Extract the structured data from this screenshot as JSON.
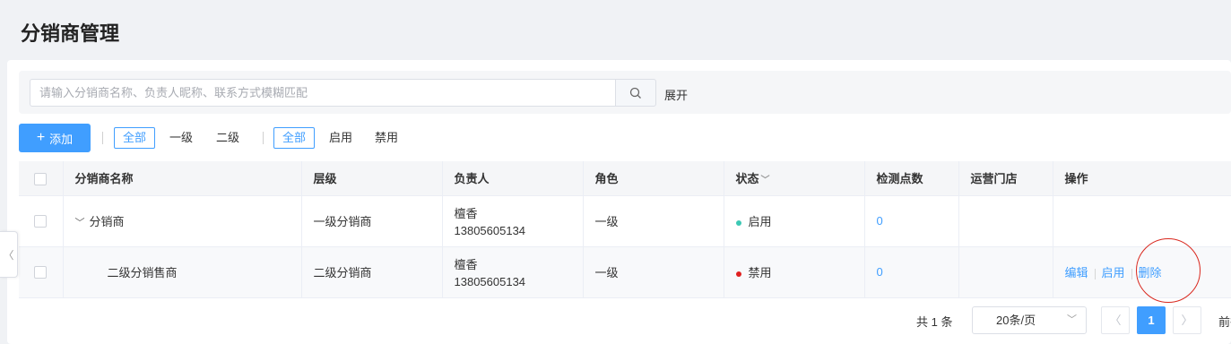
{
  "page": {
    "title": "分销商管理"
  },
  "search": {
    "placeholder": "请输入分销商名称、负责人昵称、联系方式模糊匹配",
    "value": "",
    "expand_label": "展开"
  },
  "toolbar": {
    "add_label": "添加",
    "level_filters": [
      "全部",
      "一级",
      "二级"
    ],
    "status_filters": [
      "全部",
      "启用",
      "禁用"
    ]
  },
  "table": {
    "columns": [
      "分销商名称",
      "层级",
      "负责人",
      "角色",
      "状态",
      "检测点数",
      "运营门店",
      "操作"
    ],
    "rows": [
      {
        "name": "分销商",
        "level": "一级分销商",
        "owner_name": "檀香",
        "owner_phone": "13805605134",
        "role": "一级",
        "status": "启用",
        "status_color": "#3cc8b4",
        "points": "0",
        "stores": "",
        "actions": []
      },
      {
        "name": "二级分销售商",
        "level": "二级分销商",
        "owner_name": "檀香",
        "owner_phone": "13805605134",
        "role": "一级",
        "status": "禁用",
        "status_color": "#e02020",
        "points": "0",
        "stores": "",
        "actions": [
          "编辑",
          "启用",
          "删除"
        ]
      }
    ]
  },
  "pagination": {
    "total_text": "共 1 条",
    "page_size": "20条/页",
    "current_page": "1",
    "goto_text": "前往"
  },
  "colors": {
    "accent": "#409eff",
    "annotation": "#d9281e"
  },
  "icons": {
    "search": "search-icon",
    "add": "plus-icon",
    "expand_row": "chevron-down-icon",
    "sort": "chevron-down-icon",
    "prev": "chevron-left-icon",
    "next": "chevron-right-icon",
    "collapse": "chevron-left-icon"
  }
}
